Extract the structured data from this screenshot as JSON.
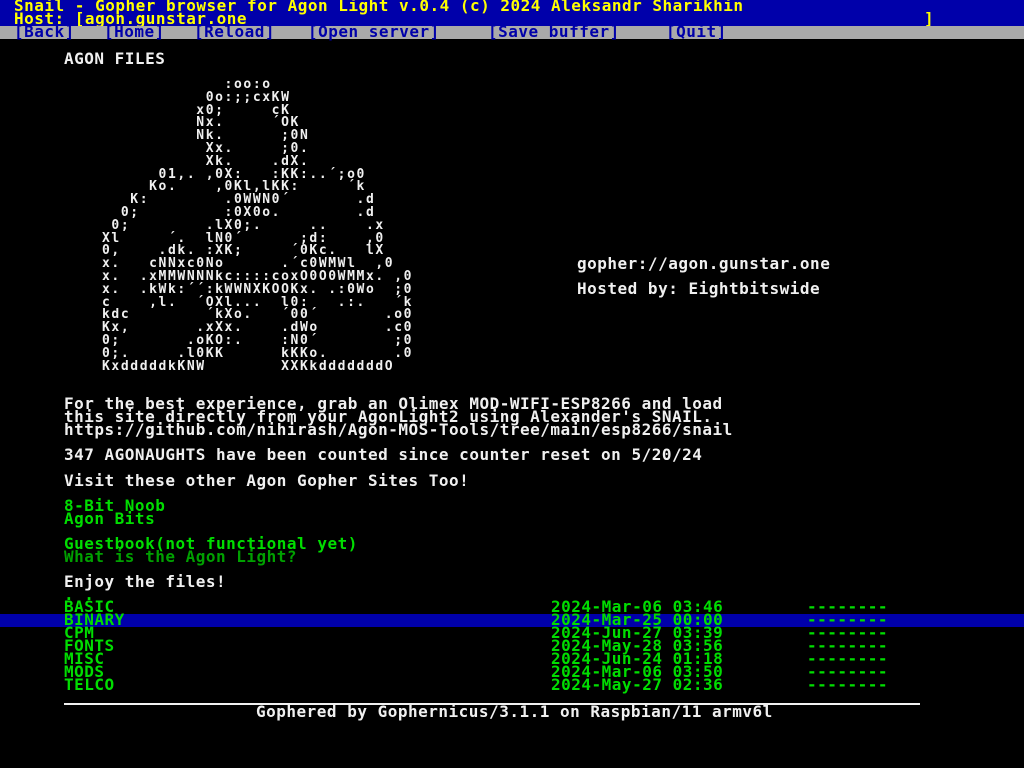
{
  "titlebar": {
    "title": "Snail - Gopher browser for Agon Light v.0.4 (c) 2024 Aleksandr Sharikhin",
    "host": "Host: [agon.gunstar.one",
    "host_close": "]"
  },
  "menu": [
    {
      "label": "[Back]"
    },
    {
      "label": "[Home]"
    },
    {
      "label": "[Reload]"
    },
    {
      "label": "[Open server]"
    },
    {
      "label": "[Save buffer]"
    },
    {
      "label": "[Quit]"
    }
  ],
  "content": {
    "heading": "AGON FILES",
    "ascii_logo": "             :oo:o\n           0o:;;cxKW\n          x0;     cK\n          Nx.     ´OK\n          Nk.      ;0N\n           Xx.     ;0.\n           Xk.    .dX.\n      01,. ,0X:   :KK:..´;o0\n     Ko.    ,0Kl,lKK:     ´k\n   K:        .0WWN0´       .d\n  0;         :0X0o.        .d\n 0;        .lX0;.     ..    .x\nXl     ´.  lN0´      ;d:    ,0\n0,    .dk. :XK;     ´0Kc.   lX\nx.   cNNxc0No      .´c0WMWl  ,0\nx.  .xMMWNNNkc::::coxO0O0WMMx. ,0\nx.  .kWk:´´:kWWNXKOOKx. .:0Wo  ;0\nc    ,l.  ´OXl...  l0:   .:.   ´k\nkdc        ´kXo.   ´00´       .o0\nKx,       .xXx.    .dWo       .c0\n0;       .oKO:.    :N0´        ;0\n0;.     .l0KK      kKKo.       .0\nKxdddddkKNW        XXKkdddddddO",
    "url": "gopher://agon.gunstar.one",
    "hosted_by": "Hosted by: Eightbitswide",
    "paragraph_line1": "For the best experience, grab an Olimex MOD-WIFI-ESP8266 and load",
    "paragraph_line2": "this site directly from your AgonLight2 using Alexander's SNAIL.",
    "paragraph_line3": "https://github.com/nihirash/Agon-MOS-Tools/tree/main/esp8266/snail",
    "counter": "347 AGONAUGHTS have been counted since counter reset on 5/20/24",
    "visit": "Visit these other Agon Gopher Sites Too!",
    "link_8bit": "8-Bit Noob",
    "link_agonbits": "Agon Bits",
    "link_guestbook": "Guestbook(not functional yet)",
    "link_whatis": "What is the Agon Light?",
    "enjoy": "Enjoy the files!",
    "parent_dir": ". .",
    "footer": "Gophered by Gophernicus/3.1.1 on Raspbian/11 armv6l"
  },
  "directories": [
    {
      "name": "BASIC",
      "date": "2024-Mar-06 03:46",
      "size": "--------"
    },
    {
      "name": "BINARY",
      "date": "2024-Mar-25 00:00",
      "size": "--------"
    },
    {
      "name": "CPM",
      "date": "2024-Jun-27 03:39",
      "size": "--------"
    },
    {
      "name": "FONTS",
      "date": "2024-May-28 03:56",
      "size": "--------"
    },
    {
      "name": "MISC",
      "date": "2024-Jun-24 01:18",
      "size": "--------"
    },
    {
      "name": "MODS",
      "date": "2024-Mar-06 03:50",
      "size": "--------"
    },
    {
      "name": "TELCO",
      "date": "2024-May-27 02:36",
      "size": "--------"
    }
  ],
  "colors": {
    "background": "#000000",
    "titlebar_bg": "#0000aa",
    "titlebar_fg": "#ffff00",
    "menubar_bg": "#aaaaaa",
    "menubar_fg": "#0000aa",
    "text": "#f0f0f0",
    "link": "#00dd00",
    "selected_bg": "#0000aa"
  }
}
